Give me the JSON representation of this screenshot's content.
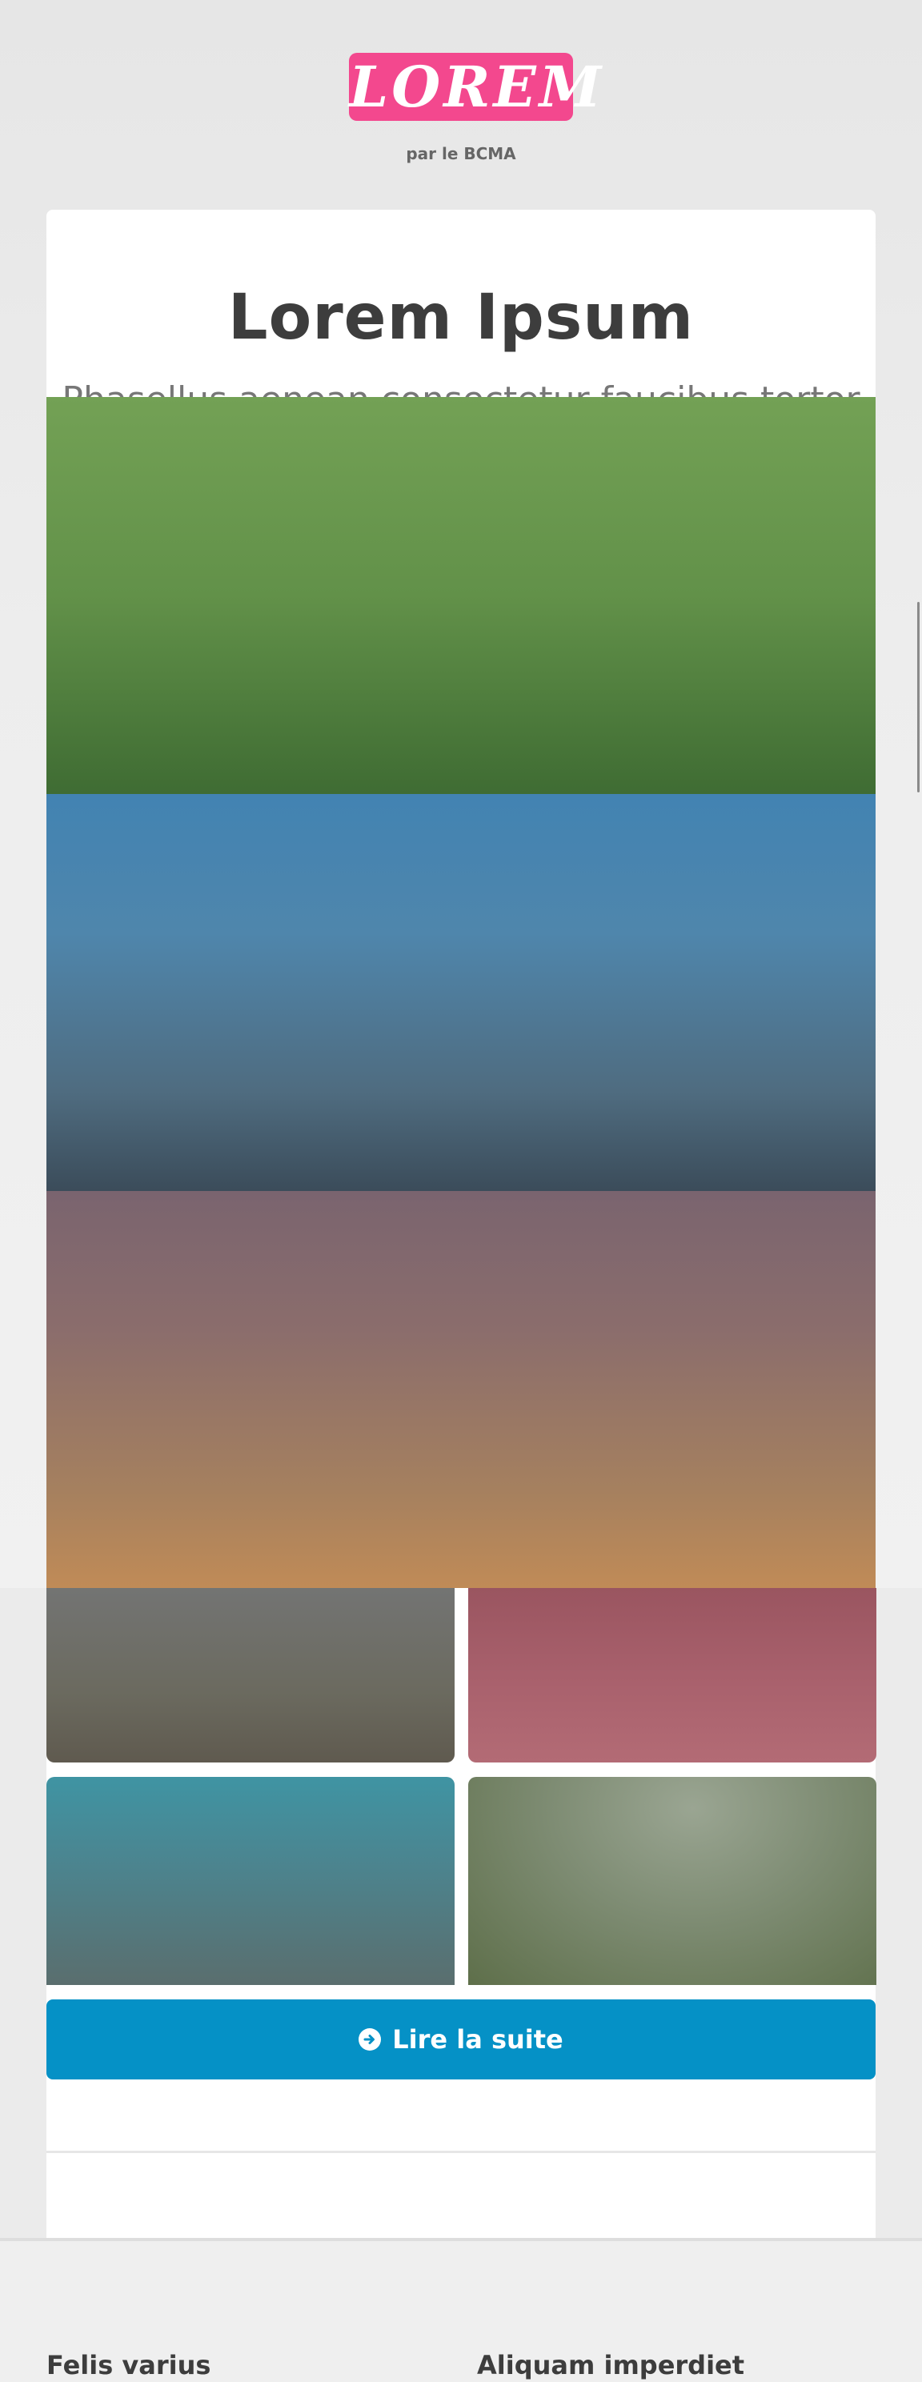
{
  "header": {
    "logo_text": "LOREM",
    "byline": "par le BCMA"
  },
  "article": {
    "title": "Lorem Ipsum",
    "subtitle": "Phasellus aenean consectetur faucibus tortor"
  },
  "read_more": {
    "label": "Lire la suite",
    "icon": "arrow-circle-right-icon"
  },
  "footer": {
    "headings": [
      "Felis varius",
      "Aliquam imperdiet"
    ]
  },
  "colors": {
    "logo_bg": "#f3488e",
    "button_bg": "#0591c6",
    "page_bg": "#ebebeb"
  }
}
